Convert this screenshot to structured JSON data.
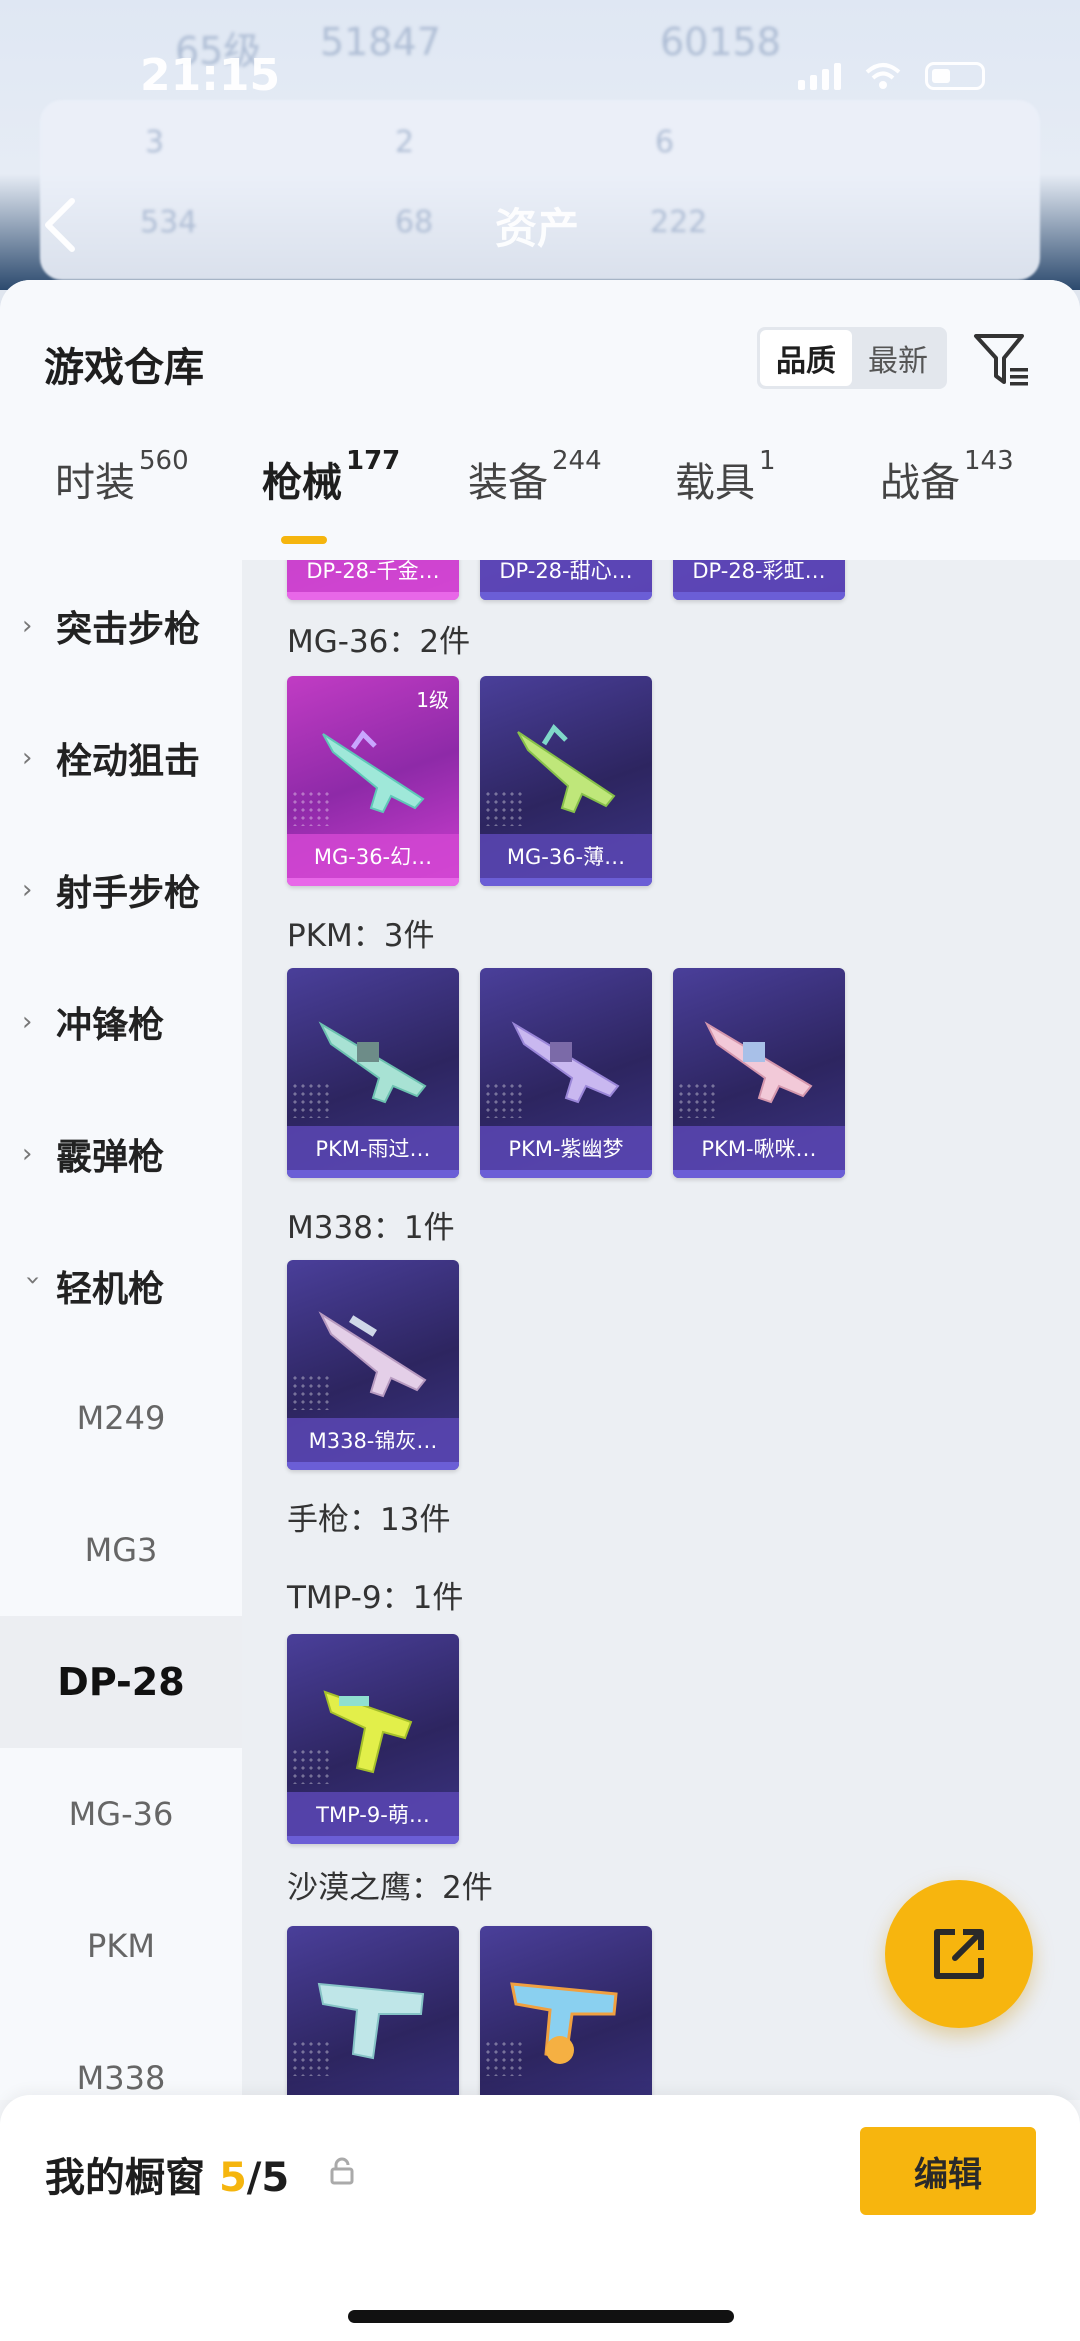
{
  "status_bar": {
    "time": "21:15"
  },
  "background": {
    "blurred_texts": [
      "65级",
      "51847",
      "60158",
      "3",
      "2",
      "6",
      "534",
      "68",
      "222"
    ],
    "title": "资产"
  },
  "sheet": {
    "title": "游戏仓库",
    "sort_options": [
      {
        "label": "品质",
        "active": true
      },
      {
        "label": "最新",
        "active": false
      }
    ],
    "tabs": [
      {
        "label": "时装",
        "count": "560",
        "active": false
      },
      {
        "label": "枪械",
        "count": "177",
        "active": true
      },
      {
        "label": "装备",
        "count": "244",
        "active": false
      },
      {
        "label": "载具",
        "count": "1",
        "active": false
      },
      {
        "label": "战备",
        "count": "143",
        "active": false
      }
    ]
  },
  "sidebar": {
    "categories": [
      {
        "label": "突击步枪",
        "expanded": false
      },
      {
        "label": "栓动狙击",
        "expanded": false
      },
      {
        "label": "射手步枪",
        "expanded": false
      },
      {
        "label": "冲锋枪",
        "expanded": false
      },
      {
        "label": "霰弹枪",
        "expanded": false
      },
      {
        "label": "轻机枪",
        "expanded": true
      }
    ],
    "subcategories": [
      {
        "label": "M249",
        "active": false
      },
      {
        "label": "MG3",
        "active": false
      },
      {
        "label": "DP-28",
        "active": true
      },
      {
        "label": "MG-36",
        "active": false
      },
      {
        "label": "PKM",
        "active": false
      },
      {
        "label": "M338",
        "active": false
      }
    ]
  },
  "content": {
    "top_partial_cards": [
      "DP-28-千金…",
      "DP-28-甜心…",
      "DP-28-彩虹…"
    ],
    "groups": [
      {
        "label": "MG-36：2件",
        "items": [
          {
            "name": "MG-36-幻…",
            "level": "1级",
            "style": "pink"
          },
          {
            "name": "MG-36-薄…",
            "level": "",
            "style": "purple"
          }
        ]
      },
      {
        "label": "PKM：3件",
        "items": [
          {
            "name": "PKM-雨过…",
            "level": "",
            "style": "purple"
          },
          {
            "name": "PKM-紫幽梦",
            "level": "",
            "style": "purple"
          },
          {
            "name": "PKM-啾咪…",
            "level": "",
            "style": "purple"
          }
        ]
      },
      {
        "label": "M338：1件",
        "items": [
          {
            "name": "M338-锦灰…",
            "level": "",
            "style": "purple"
          }
        ]
      },
      {
        "label": "手枪：13件",
        "items": []
      },
      {
        "label": "TMP-9：1件",
        "items": [
          {
            "name": "TMP-9-萌…",
            "level": "",
            "style": "purple"
          }
        ]
      },
      {
        "label": "沙漠之鹰：2件",
        "items": [
          {
            "name": "",
            "level": "",
            "style": "purple"
          },
          {
            "name": "",
            "level": "",
            "style": "purple"
          }
        ]
      }
    ]
  },
  "fab": {
    "icon": "share-icon"
  },
  "showcase": {
    "label": "我的橱窗",
    "used": "5",
    "total": "/5",
    "edit_label": "编辑"
  },
  "colors": {
    "accent": "#f7b50e",
    "card_purple": "#3a2f7a",
    "card_pink": "#c13cc4"
  }
}
